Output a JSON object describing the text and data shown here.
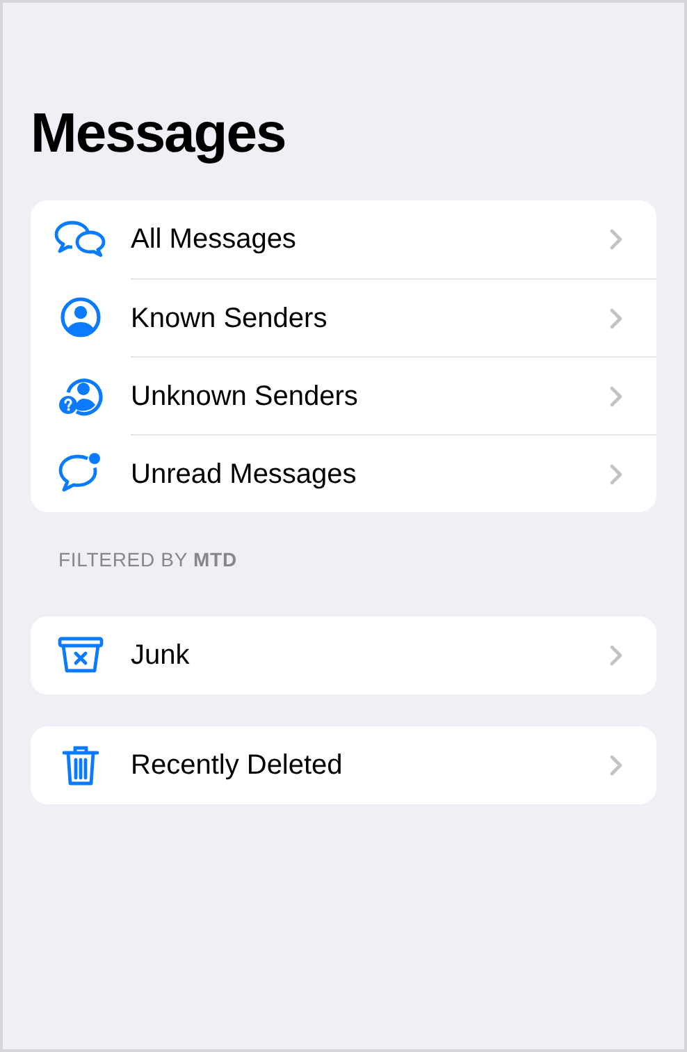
{
  "title": "Messages",
  "groups": [
    {
      "items": [
        {
          "kind": "all",
          "label": "All Messages"
        },
        {
          "kind": "known",
          "label": "Known Senders"
        },
        {
          "kind": "unknown",
          "label": "Unknown Senders"
        },
        {
          "kind": "unread",
          "label": "Unread Messages"
        }
      ]
    },
    {
      "header": "FILTERED BY **MTD**",
      "items": [
        {
          "kind": "junk",
          "label": "Junk"
        }
      ]
    },
    {
      "items": [
        {
          "kind": "deleted",
          "label": "Recently Deleted"
        }
      ]
    }
  ]
}
